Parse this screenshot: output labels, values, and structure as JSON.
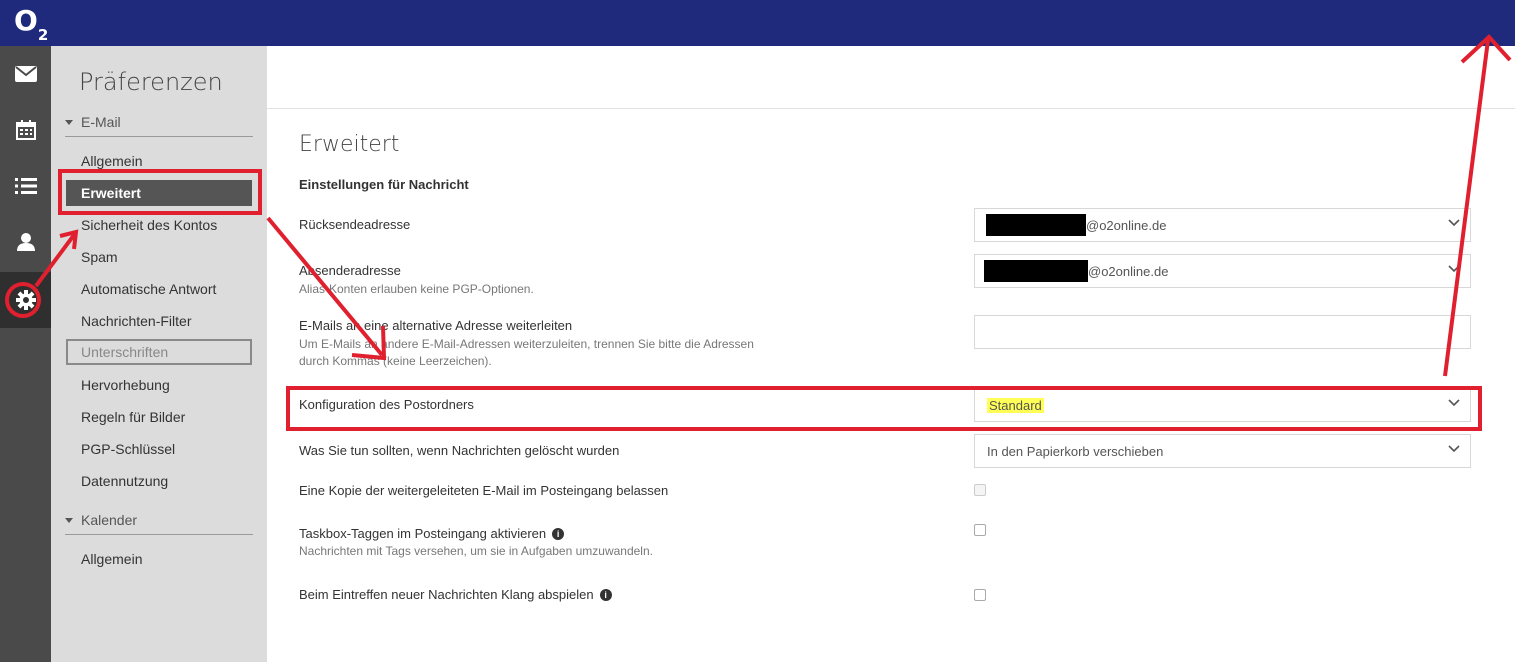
{
  "brand": {
    "logo": "O",
    "logo_sub": "2"
  },
  "rail": {
    "items": [
      "mail-icon",
      "calendar-icon",
      "tasks-list-icon",
      "contacts-icon",
      "settings-gear-icon"
    ],
    "active": "settings-gear-icon"
  },
  "sidebar": {
    "title": "Präferenzen",
    "email_section": "E-Mail",
    "email_items": [
      "Allgemein",
      "Erweitert",
      "Sicherheit des Kontos",
      "Spam",
      "Automatische Antwort",
      "Nachrichten-Filter",
      "Unterschriften",
      "Hervorhebung",
      "Regeln für Bilder",
      "PGP-Schlüssel",
      "Datennutzung"
    ],
    "active_item": "Erweitert",
    "calendar_section": "Kalender",
    "calendar_items": [
      "Allgemein"
    ]
  },
  "main": {
    "title": "Erweitert",
    "section": "Einstellungen für Nachricht",
    "reply_to": {
      "label": "Rücksendeadresse",
      "value_suffix": "@o2online.de"
    },
    "sender": {
      "label": "Absenderadresse",
      "help": "Alias-Konten erlauben keine PGP-Optionen.",
      "value_suffix": "@o2online.de"
    },
    "forward": {
      "label": "E-Mails an eine alternative Adresse weiterleiten",
      "help1": "Um E-Mails an andere E-Mail-Adressen weiterzuleiten, trennen Sie bitte die Adressen",
      "help2": "durch Kommas (keine Leerzeichen).",
      "value": ""
    },
    "mailbox_config": {
      "label": "Konfiguration des Postordners",
      "value": "Standard"
    },
    "delete_action": {
      "label": "Was Sie tun sollten, wenn Nachrichten gelöscht wurden",
      "value": "In den Papierkorb verschieben"
    },
    "keep_copy": {
      "label": "Eine Kopie der weitergeleiteten E-Mail im Posteingang belassen"
    },
    "taskbox": {
      "label": "Taskbox-Taggen im Posteingang aktivieren",
      "help": "Nachrichten mit Tags versehen, um sie in Aufgaben umzuwandeln."
    },
    "sound": {
      "label": "Beim Eintreffen neuer Nachrichten Klang abspielen"
    }
  },
  "colors": {
    "topbar": "#1f2a7c",
    "annotation": "#e0202e",
    "highlight": "#ffff55"
  }
}
